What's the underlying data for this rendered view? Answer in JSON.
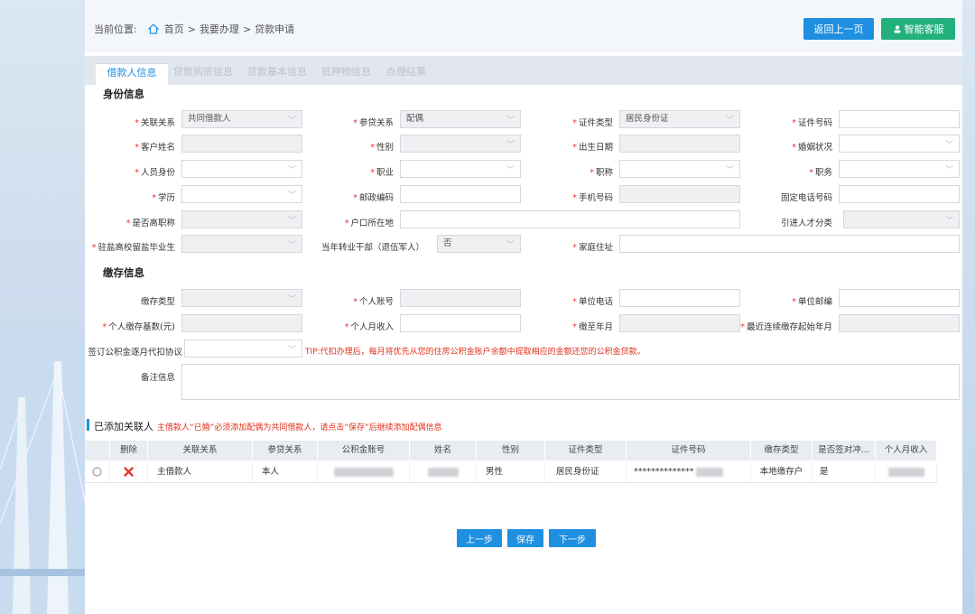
{
  "breadcrumb": {
    "prefix": "当前位置:",
    "home": "首页",
    "sep1": ">",
    "level2": "我要办理",
    "sep2": ">",
    "level3": "贷款申请"
  },
  "header": {
    "back_button": "返回上一页",
    "service_button": "智能客服"
  },
  "tabs": [
    {
      "label": "借款人信息",
      "active": true
    },
    {
      "label": "贷款购房信息",
      "active": false
    },
    {
      "label": "贷款基本信息",
      "active": false
    },
    {
      "label": "抵押物信息",
      "active": false
    },
    {
      "label": "办理结果",
      "active": false
    }
  ],
  "identity": {
    "title": "身份信息",
    "relation_label": "关联关系",
    "relation_value": "共同借款人",
    "loan_relation_label": "参贷关系",
    "loan_relation_value": "配偶",
    "id_type_label": "证件类型",
    "id_type_value": "居民身份证",
    "id_no_label": "证件号码",
    "name_label": "客户姓名",
    "gender_label": "性别",
    "birth_label": "出生日期",
    "marital_label": "婚姻状况",
    "identity_label": "人员身份",
    "job_label": "职业",
    "title_label": "职称",
    "position_label": "职务",
    "edu_label": "学历",
    "zip_label": "邮政编码",
    "mobile_label": "手机号码",
    "phone_label": "固定电话号码",
    "senior_label": "是否高职称",
    "hukou_label": "户口所在地",
    "talent_label": "引进人才分类",
    "grad_label": "驻盐高校留盐毕业生",
    "cadre_label": "当年转业干部（退伍军人）",
    "cadre_value": "否",
    "address_label": "家庭住址"
  },
  "deposit": {
    "title": "缴存信息",
    "type_label": "缴存类型",
    "account_label": "个人账号",
    "unit_phone_label": "单位电话",
    "unit_zip_label": "单位邮编",
    "base_label": "个人缴存基数(元)",
    "income_label": "个人月收入",
    "until_label": "缴至年月",
    "start_label": "最近连续缴存起始年月",
    "agreement_label": "签订公积金逐月代扣协议",
    "tip": "TIP:代扣办理后，每月将优先从您的住房公积金账户余额中提取相应的金额还您的公积金贷款。",
    "remark_label": "备注信息"
  },
  "related": {
    "title": "已添加关联人",
    "note": "主借款人“已婚”必须添加配偶为共同借款人，请点击“保存”后继续添加配偶信息",
    "headers": [
      "删除",
      "关联关系",
      "参贷关系",
      "公积金账号",
      "姓名",
      "性别",
      "证件类型",
      "证件号码",
      "缴存类型",
      "是否签对冲...",
      "个人月收入"
    ],
    "rows": [
      {
        "relation": "主借款人",
        "loan_relation": "本人",
        "gender": "男性",
        "id_type": "居民身份证",
        "id_no": "**************",
        "deposit_type": "本地缴存户",
        "signed": "是"
      }
    ]
  },
  "footer": {
    "prev": "上一步",
    "save": "保存",
    "next": "下一步"
  },
  "colors": {
    "primary": "#1e8fe1",
    "success": "#22b07d",
    "required": "#e33333",
    "tip": "#e0301e"
  }
}
